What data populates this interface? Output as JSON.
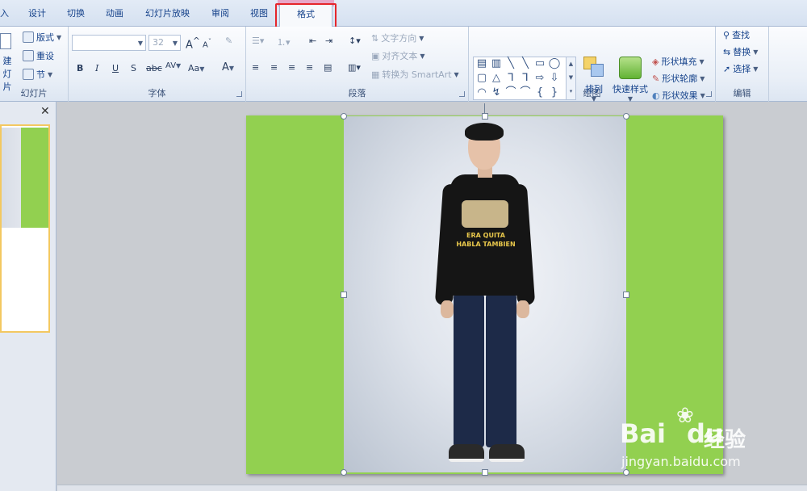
{
  "tabs": [
    "入",
    "设计",
    "切换",
    "动画",
    "幻灯片放映",
    "审阅",
    "视图",
    "格式"
  ],
  "active_tab": "格式",
  "ribbon": {
    "slides_group": {
      "label": "幻灯片",
      "new_slide_lines": [
        "建",
        "灯片"
      ],
      "layout": "版式",
      "reset": "重设",
      "section": "节"
    },
    "font_group": {
      "label": "字体",
      "font_name": "",
      "font_size": "32",
      "bold": "B",
      "italic": "I",
      "underline": "U",
      "shadow": "S",
      "strike": "abc",
      "spacing": "AV",
      "case": "Aa",
      "color": "A",
      "grow": "A",
      "shrink": "A"
    },
    "paragraph_group": {
      "label": "段落",
      "text_direction": "文字方向",
      "align_text": "对齐文本",
      "convert_smartart": "转换为 SmartArt"
    },
    "drawing_group": {
      "label": "绘图",
      "arrange": "排列",
      "quick_styles": "快速样式",
      "shape_fill": "形状填充",
      "shape_outline": "形状轮廓",
      "shape_effects": "形状效果"
    },
    "editing_group": {
      "label": "编辑",
      "find": "查找",
      "replace": "替换",
      "select": "选择"
    }
  },
  "gallery_shapes": [
    "▤",
    "▥",
    "╲",
    "╲",
    "▭",
    "◯",
    "▢",
    "△",
    "⅂",
    "⅂",
    "⇨",
    "⇩",
    "◠",
    "↯",
    "⌒",
    "⌒",
    "{",
    "}"
  ],
  "left_pane": {
    "close": "✕"
  },
  "slide": {
    "background_color": "#92d050"
  },
  "photo": {
    "shirt_print_lines": [
      "ERA QUITA",
      "HABLA TAMBIEN"
    ]
  },
  "watermark": {
    "logo": "Bai",
    "logo_suffix": "du",
    "cn": "经验",
    "url": "jingyan.baidu.com"
  },
  "colors": {
    "accent_red": "#e5262b",
    "tab_pink": "#e8a6c7",
    "ribbon_text": "#15428b"
  }
}
